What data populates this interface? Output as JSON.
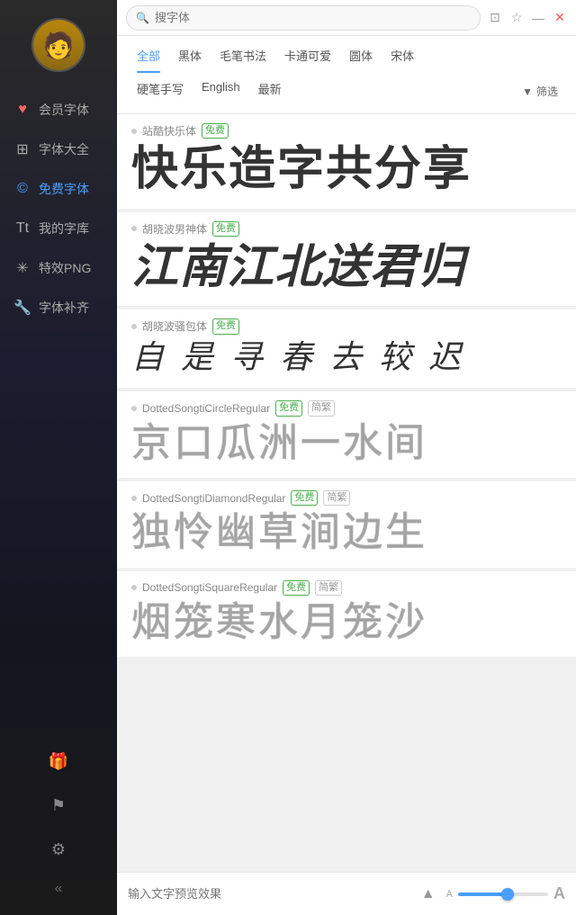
{
  "sidebar": {
    "nav_items": [
      {
        "id": "vip-fonts",
        "icon": "♥",
        "label": "会员字体",
        "icon_color": "#ff6666",
        "active": false
      },
      {
        "id": "font-collection",
        "icon": "⊞",
        "label": "字体大全",
        "active": false
      },
      {
        "id": "free-fonts",
        "icon": "©",
        "label": "免费字体",
        "active": true
      },
      {
        "id": "my-library",
        "icon": "Tt",
        "label": "我的字库",
        "active": false
      },
      {
        "id": "effect-png",
        "icon": "✳",
        "label": "特效PNG",
        "active": false
      },
      {
        "id": "font-supplement",
        "icon": "🔧",
        "label": "字体补齐",
        "active": false
      }
    ],
    "bottom_items": [
      {
        "id": "gift",
        "icon": "🎁"
      },
      {
        "id": "flag",
        "icon": "⚑"
      },
      {
        "id": "settings",
        "icon": "⚙"
      }
    ],
    "collapse_icon": "«"
  },
  "titlebar": {
    "search_placeholder": "搜字体",
    "actions": [
      "⊡",
      "☆",
      "—",
      "✕"
    ]
  },
  "filter": {
    "row1": [
      {
        "label": "全部",
        "active": true
      },
      {
        "label": "黑体",
        "active": false
      },
      {
        "label": "毛笔书法",
        "active": false
      },
      {
        "label": "卡通可爱",
        "active": false
      },
      {
        "label": "圆体",
        "active": false
      },
      {
        "label": "宋体",
        "active": false
      }
    ],
    "row2": [
      {
        "label": "硬笔手写",
        "active": false
      },
      {
        "label": "English",
        "active": false
      },
      {
        "label": "最新",
        "active": false
      }
    ],
    "filter_btn": "筛选"
  },
  "fonts": [
    {
      "id": "zhankukuaile",
      "name": "站酷快乐体",
      "badges": [
        {
          "label": "免费",
          "type": "free"
        }
      ],
      "preview": "快乐造字共分享",
      "style": "bold"
    },
    {
      "id": "huxiaobo-nanshen",
      "name": "胡晓波男神体",
      "badges": [
        {
          "label": "免费",
          "type": "free"
        }
      ],
      "preview": "江南江北送君归",
      "style": "bold-italic"
    },
    {
      "id": "huxiaobo-xia",
      "name": "胡晓波骚包体",
      "badges": [
        {
          "label": "免费",
          "type": "free"
        }
      ],
      "preview": "自 是 寻 春 去 较 迟",
      "style": "cursive"
    },
    {
      "id": "dotted-circle",
      "name": "DottedSongtiCircleRegular",
      "badges": [
        {
          "label": "免费",
          "type": "free"
        },
        {
          "label": "简繁",
          "type": "jianfan"
        }
      ],
      "preview": "京口瓜洲一水间",
      "style": "dotted"
    },
    {
      "id": "dotted-diamond",
      "name": "DottedSongtiDiamondRegular",
      "badges": [
        {
          "label": "免费",
          "type": "free"
        },
        {
          "label": "简繁",
          "type": "jianfan"
        }
      ],
      "preview": "独怜幽草涧边生",
      "style": "dotted"
    },
    {
      "id": "dotted-square",
      "name": "DottedSongtiSquareRegular",
      "badges": [
        {
          "label": "免费",
          "type": "free"
        },
        {
          "label": "简繁",
          "type": "jianfan"
        }
      ],
      "preview": "烟笼寒水月笼沙",
      "style": "dotted"
    }
  ],
  "bottom_bar": {
    "placeholder": "输入文字预览效果",
    "size_label_left": "A",
    "size_label_right": "A",
    "slider_percent": 55
  }
}
